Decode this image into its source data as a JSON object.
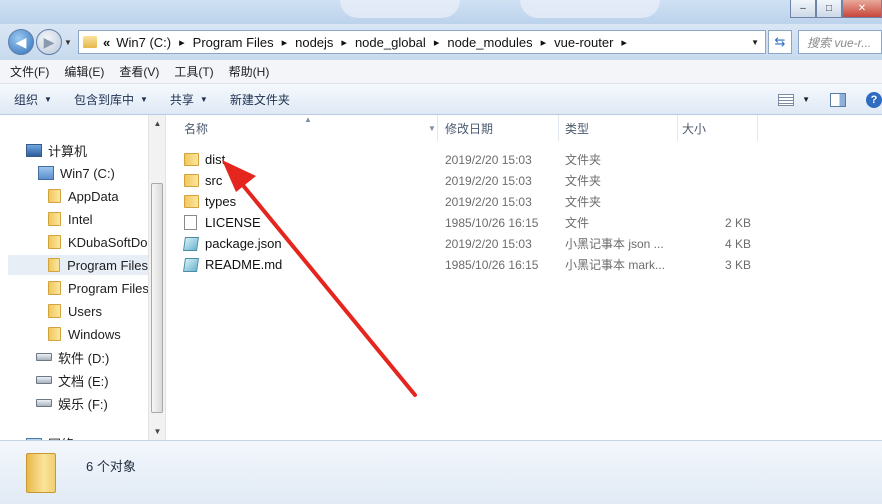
{
  "address": {
    "lead": "«",
    "crumbs": [
      "Win7 (C:)",
      "Program Files",
      "nodejs",
      "node_global",
      "node_modules",
      "vue-router"
    ],
    "search_placeholder": "搜索 vue-r..."
  },
  "menu": [
    "文件(F)",
    "编辑(E)",
    "查看(V)",
    "工具(T)",
    "帮助(H)"
  ],
  "commands": [
    {
      "label": "组织",
      "caret": true
    },
    {
      "label": "包含到库中",
      "caret": true
    },
    {
      "label": "共享",
      "caret": true
    },
    {
      "label": "新建文件夹",
      "caret": false
    }
  ],
  "nav": {
    "computer": "计算机",
    "system_drive": "Win7 (C:)",
    "folders": [
      "AppData",
      "Intel",
      "KDubaSoftDo",
      "Program Files",
      "Program Files",
      "Users",
      "Windows"
    ],
    "drives": [
      "软件 (D:)",
      "文档 (E:)",
      "娱乐 (F:)"
    ],
    "network": "网络"
  },
  "columns": {
    "name": "名称",
    "date": "修改日期",
    "type": "类型",
    "size": "大小"
  },
  "files": [
    {
      "icon": "folder-icon",
      "name": "dist",
      "date": "2019/2/20 15:03",
      "type": "文件夹",
      "size": ""
    },
    {
      "icon": "folder-icon",
      "name": "src",
      "date": "2019/2/20 15:03",
      "type": "文件夹",
      "size": ""
    },
    {
      "icon": "folder-icon",
      "name": "types",
      "date": "2019/2/20 15:03",
      "type": "文件夹",
      "size": ""
    },
    {
      "icon": "file-icon",
      "name": "LICENSE",
      "date": "1985/10/26 16:15",
      "type": "文件",
      "size": "2 KB"
    },
    {
      "icon": "notepad-icon",
      "name": "package.json",
      "date": "2019/2/20 15:03",
      "type": "小黑记事本 json ...",
      "size": "4 KB"
    },
    {
      "icon": "notepad-icon",
      "name": "README.md",
      "date": "1985/10/26 16:15",
      "type": "小黑记事本 mark...",
      "size": "3 KB"
    }
  ],
  "status": {
    "text": "6 个对象"
  },
  "colors": {
    "arrow": "#e5261f",
    "selection": "#e8eef6"
  }
}
